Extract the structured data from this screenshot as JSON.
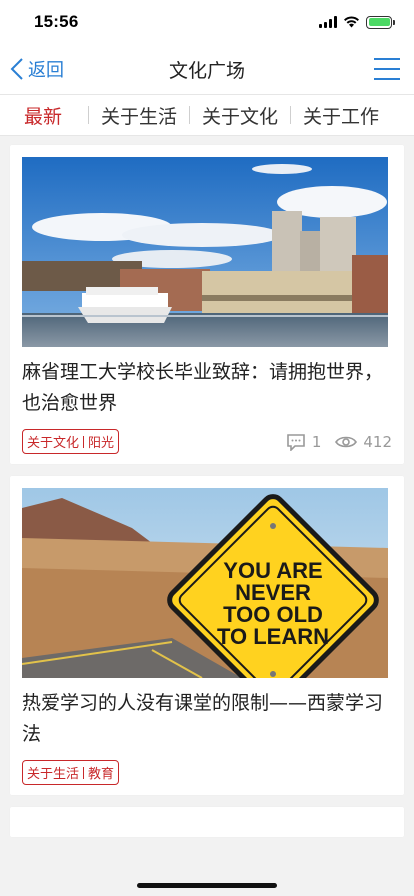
{
  "status": {
    "time": "15:56"
  },
  "nav": {
    "back_label": "返回",
    "title": "文化广场"
  },
  "tabs": [
    {
      "label": "最新",
      "active": true
    },
    {
      "label": "关于生活",
      "active": false
    },
    {
      "label": "关于文化",
      "active": false
    },
    {
      "label": "关于工作",
      "active": false
    }
  ],
  "articles": [
    {
      "title": "麻省理工大学校长毕业致辞：请拥抱世界，也治愈世界",
      "tag_primary": "关于文化",
      "tag_secondary": "阳光",
      "comments": "1",
      "views": "412"
    },
    {
      "title": "热爱学习的人没有课堂的限制——西蒙学习法",
      "tag_primary": "关于生活",
      "tag_secondary": "教育",
      "sign_lines": [
        "YOU ARE",
        "NEVER",
        "TOO OLD",
        "TO LEARN"
      ]
    }
  ],
  "colors": {
    "accent_blue": "#2a7fd4",
    "accent_red": "#c8282a",
    "battery_green": "#4cd964"
  }
}
